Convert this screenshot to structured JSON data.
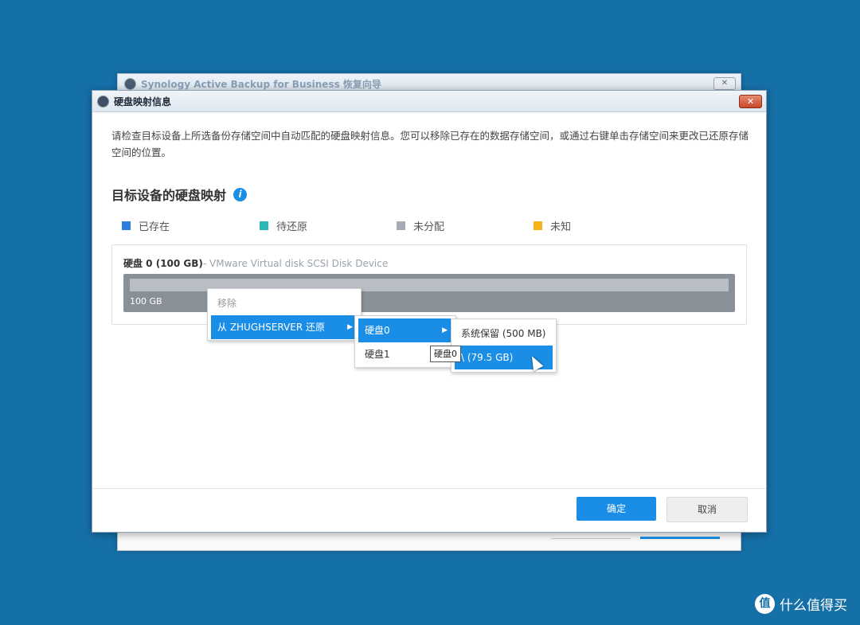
{
  "back_window": {
    "title": "Synology Active Backup for Business 恢复向导",
    "close_label": "✕"
  },
  "window": {
    "title": "硬盘映射信息",
    "close_label": "✕"
  },
  "description": "请检查目标设备上所选备份存储空间中自动匹配的硬盘映射信息。您可以移除已存在的数据存储空间，或通过右键单击存储空间来更改已还原存储空间的位置。",
  "section_title": "目标设备的硬盘映射",
  "legend": [
    {
      "label": "已存在",
      "color": "#2e7de0"
    },
    {
      "label": "待还原",
      "color": "#2ab7b7"
    },
    {
      "label": "未分配",
      "color": "#a6acb3"
    },
    {
      "label": "未知",
      "color": "#f5b21c"
    }
  ],
  "disk": {
    "name": "硬盘 0 (100 GB)",
    "device": "- VMware Virtual disk SCSI Disk Device",
    "size": "100 GB"
  },
  "context_menu": {
    "remove": "移除",
    "restore_from": "从 ZHUGHSERVER 还原",
    "disks": [
      "硬盘0",
      "硬盘1"
    ],
    "volumes": [
      "系统保留 (500 MB)",
      "\\ (79.5 GB)"
    ]
  },
  "tooltip": "硬盘0",
  "buttons": {
    "ok": "确定",
    "cancel": "取消"
  },
  "watermark": {
    "logo": "值",
    "text": "什么值得买"
  }
}
